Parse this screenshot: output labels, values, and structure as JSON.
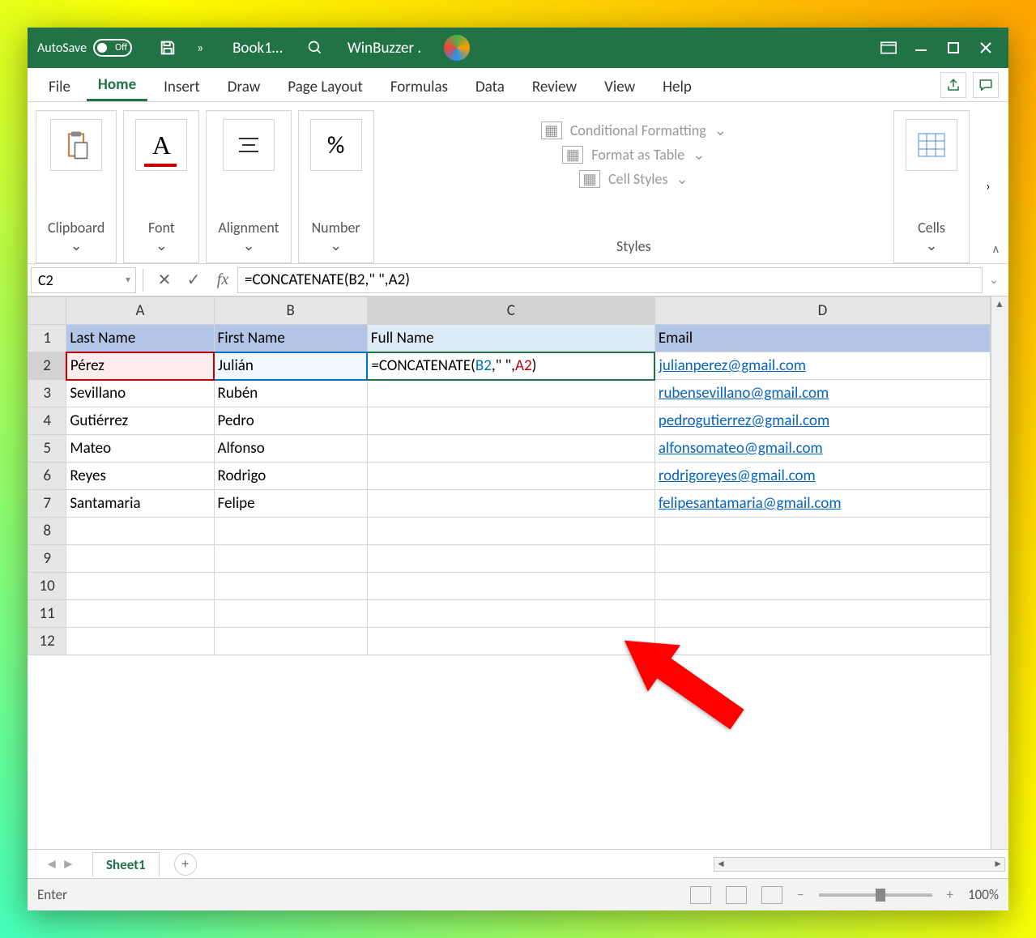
{
  "titlebar": {
    "autosave_label": "AutoSave",
    "autosave_state": "Off",
    "file_title": "Book1…",
    "more": "»",
    "user_display": "WinBuzzer ."
  },
  "tabs": {
    "items": [
      "File",
      "Home",
      "Insert",
      "Draw",
      "Page Layout",
      "Formulas",
      "Data",
      "Review",
      "View",
      "Help"
    ],
    "active": "Home"
  },
  "ribbon": {
    "clipboard": "Clipboard",
    "font": "Font",
    "alignment": "Alignment",
    "number": "Number",
    "number_glyph": "%",
    "styles_label": "Styles",
    "cond_fmt": "Conditional Formatting",
    "fmt_table": "Format as Table",
    "cell_styles": "Cell Styles",
    "cells": "Cells"
  },
  "formulabar": {
    "cell_ref": "C2",
    "formula_display": "=CONCATENATE(B2,\" \",A2)",
    "fn": "=CONCATENATE(",
    "ref1": "B2",
    "mid": ",\" \",",
    "ref2": "A2",
    "tail": ")"
  },
  "sheet": {
    "columns": [
      "A",
      "B",
      "C",
      "D"
    ],
    "headers": {
      "A": "Last Name",
      "B": "First Name",
      "C": "Full Name",
      "D": "Email"
    },
    "editing_cell_text": "=CONCATENATE(B2,\" \",A2)",
    "rows": [
      {
        "n": 1
      },
      {
        "n": 2,
        "A": "Pérez",
        "B": "Julián",
        "D": "julianperez@gmail.com"
      },
      {
        "n": 3,
        "A": "Sevillano",
        "B": "Rubén",
        "D": "rubensevillano@gmail.com"
      },
      {
        "n": 4,
        "A": "Gutiérrez",
        "B": "Pedro",
        "D": "pedrogutierrez@gmail.com"
      },
      {
        "n": 5,
        "A": "Mateo",
        "B": "Alfonso",
        "D": "alfonsomateo@gmail.com"
      },
      {
        "n": 6,
        "A": "Reyes",
        "B": "Rodrigo",
        "D": "rodrigoreyes@gmail.com"
      },
      {
        "n": 7,
        "A": "Santamaria",
        "B": "Felipe",
        "D": "felipesantamaria@gmail.com"
      },
      {
        "n": 8
      },
      {
        "n": 9
      },
      {
        "n": 10
      },
      {
        "n": 11
      },
      {
        "n": 12
      }
    ]
  },
  "sheettabs": {
    "active": "Sheet1"
  },
  "statusbar": {
    "mode": "Enter",
    "zoom": "100%"
  }
}
